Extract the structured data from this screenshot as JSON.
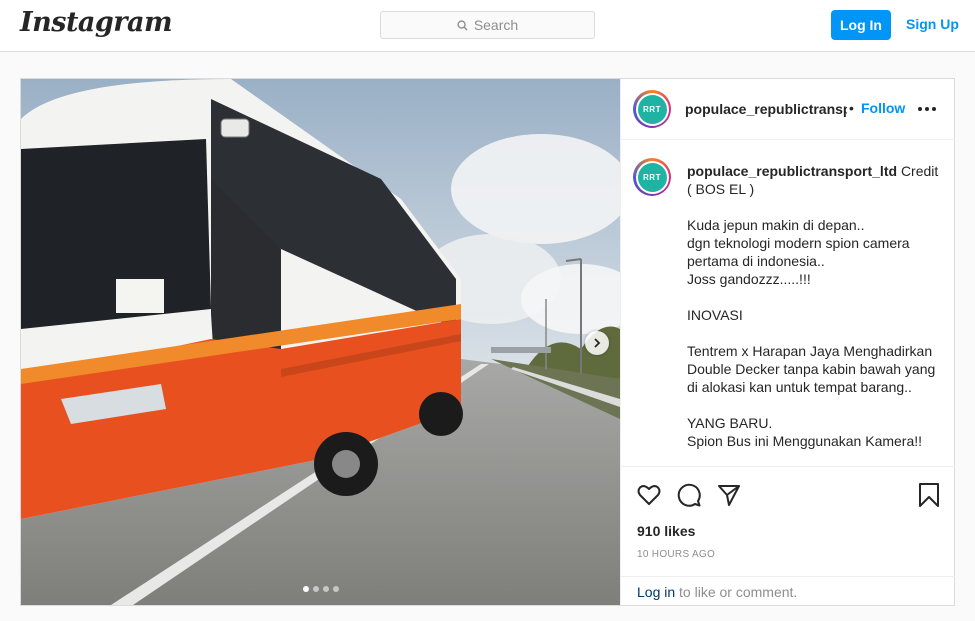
{
  "nav": {
    "logo": "Instagram",
    "search_placeholder": "Search",
    "login_label": "Log In",
    "signup_label": "Sign Up"
  },
  "post": {
    "header": {
      "username": "populace_republictransport_ltd",
      "separator": "•",
      "follow_label": "Follow",
      "avatar_text": "RRT"
    },
    "caption": {
      "username": "populace_republictransport_ltd",
      "lines": [
        "Credit ( BOS EL )",
        "",
        "Kuda jepun makin di depan..",
        "dgn teknologi modern spion camera pertama di indonesia..",
        "Joss gandozzz.....!!!",
        "",
        "INOVASI",
        "",
        "Tentrem x Harapan Jaya Menghadirkan Double Decker tanpa kabin bawah yang di alokasi kan untuk tempat barang..",
        "",
        "YANG BARU.",
        "Spion Bus ini Menggunakan Kamera!!"
      ]
    },
    "media": {
      "carousel_count": 4,
      "active_index": 0
    },
    "likes": "910 likes",
    "timestamp": "10 HOURS AGO",
    "comment": {
      "login_link": "Log in",
      "prompt": "to like or comment."
    }
  },
  "colors": {
    "accent": "#0095f6",
    "border": "#dbdbdb",
    "background": "#fafafa"
  }
}
